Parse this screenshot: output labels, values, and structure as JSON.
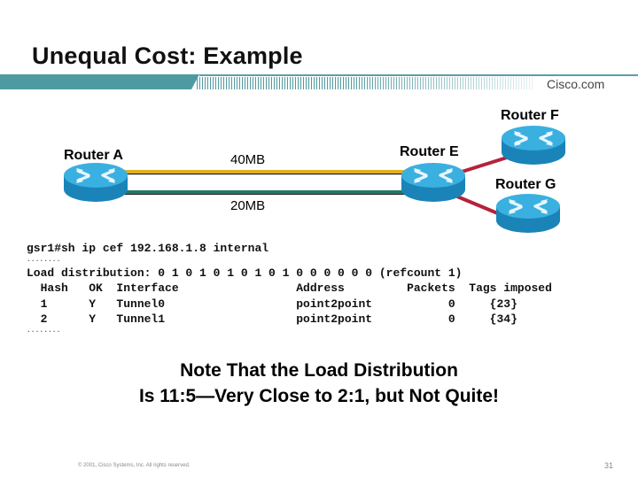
{
  "slide": {
    "title": "Unequal Cost: Example",
    "brand": "Cisco.com",
    "colors": {
      "accent_bar": "#4e9aa1",
      "link_40mb": "#e0b020",
      "link_20mb": "#1f7a66",
      "link_red": "#b5223a",
      "router_top": "#3ab0e0",
      "router_side": "#1a84b8"
    }
  },
  "diagram": {
    "routers": [
      {
        "id": "A",
        "label": "Router A"
      },
      {
        "id": "E",
        "label": "Router E"
      },
      {
        "id": "F",
        "label": "Router F"
      },
      {
        "id": "G",
        "label": "Router G"
      }
    ],
    "links": [
      {
        "from": "A",
        "to": "E",
        "label": "40MB",
        "color": "gold"
      },
      {
        "from": "A",
        "to": "E",
        "label": "20MB",
        "color": "green"
      },
      {
        "from": "E",
        "to": "F",
        "label": "",
        "color": "red"
      },
      {
        "from": "E",
        "to": "G",
        "label": "",
        "color": "red"
      }
    ],
    "icon": "router-icon"
  },
  "cli": {
    "command": "gsr1#sh ip cef 192.168.1.8 internal",
    "ellipsis": "........",
    "load_distribution": "Load distribution: 0 1 0 1 0 1 0 1 0 1 0 0 0 0 0 0 (refcount 1)",
    "header": "  Hash   OK  Interface                 Address         Packets  Tags imposed",
    "rows": [
      "  1      Y   Tunnel0                   point2point           0     {23}",
      "  2      Y   Tunnel1                   point2point           0     {34}"
    ]
  },
  "note": {
    "line1": "Note That the Load Distribution",
    "line2": "Is 11:5—Very Close to 2:1, but Not Quite!"
  },
  "footer": {
    "copyright": "© 2001, Cisco Systems, Inc. All rights reserved.",
    "page": "31"
  }
}
